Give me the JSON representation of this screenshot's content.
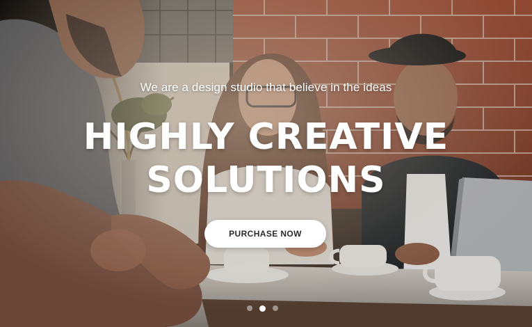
{
  "hero": {
    "tagline": "We are a design studio that believe in the ideas",
    "headline_line1": "HIGHLY CREATIVE",
    "headline_line2": "SOLUTIONS",
    "cta_label": "PURCHASE NOW"
  },
  "slider": {
    "total_slides": 3,
    "active_slide": 2
  },
  "colors": {
    "cta_background": "#ffffff",
    "cta_text": "#2a2a2a",
    "headline_text": "#ffffff",
    "brick": "#9a4a34"
  }
}
